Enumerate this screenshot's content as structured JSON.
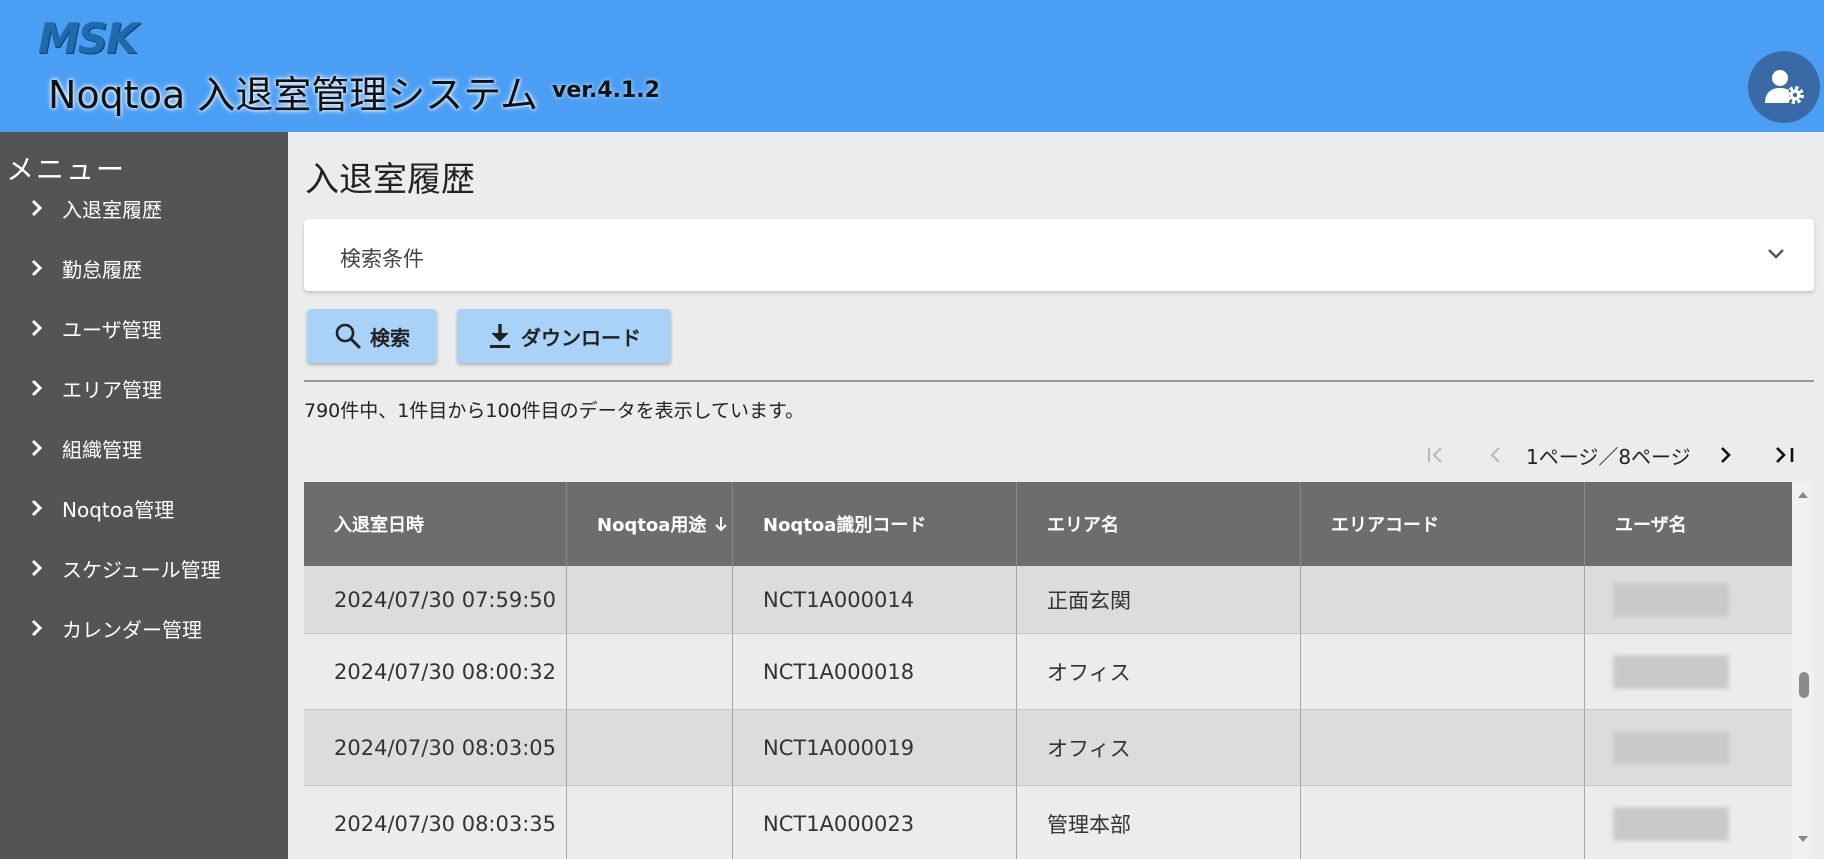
{
  "header": {
    "logo": "MSK",
    "title": "Noqtoa 入退室管理システム",
    "version": "ver.4.1.2",
    "user_settings_icon": "user-gear-icon"
  },
  "sidebar": {
    "title": "メニュー",
    "items": [
      {
        "label": "入退室履歴"
      },
      {
        "label": "勤怠履歴"
      },
      {
        "label": "ユーザ管理"
      },
      {
        "label": "エリア管理"
      },
      {
        "label": "組織管理"
      },
      {
        "label": "Noqtoa管理"
      },
      {
        "label": "スケジュール管理"
      },
      {
        "label": "カレンダー管理"
      }
    ]
  },
  "main": {
    "page_title": "入退室履歴",
    "search_panel_label": "検索条件",
    "search_button": "検索",
    "download_button": "ダウンロード",
    "record_summary": "790件中、1件目から100件目のデータを表示しています。",
    "pagination": "1ページ／8ページ"
  },
  "table": {
    "columns": [
      "入退室日時",
      "Noqtoa用途",
      "Noqtoa識別コード",
      "エリア名",
      "エリアコード",
      "ユーザ名"
    ],
    "sort_column": "Noqtoa用途",
    "sort_direction": "descending",
    "rows": [
      {
        "datetime": "2024/07/30 07:59:50",
        "purpose": "",
        "code": "NCT1A000014",
        "area": "正面玄関",
        "area_code": "",
        "user": ""
      },
      {
        "datetime": "2024/07/30 08:00:32",
        "purpose": "",
        "code": "NCT1A000018",
        "area": "オフィス",
        "area_code": "",
        "user": ""
      },
      {
        "datetime": "2024/07/30 08:03:05",
        "purpose": "",
        "code": "NCT1A000019",
        "area": "オフィス",
        "area_code": "",
        "user": ""
      },
      {
        "datetime": "2024/07/30 08:03:35",
        "purpose": "",
        "code": "NCT1A000023",
        "area": "管理本部",
        "area_code": "",
        "user": ""
      }
    ]
  },
  "colors": {
    "header_bg": "#4a9ff5",
    "sidebar_bg": "#545454",
    "button_bg": "#a9d2f8",
    "table_header_bg": "#6d6d6d"
  }
}
